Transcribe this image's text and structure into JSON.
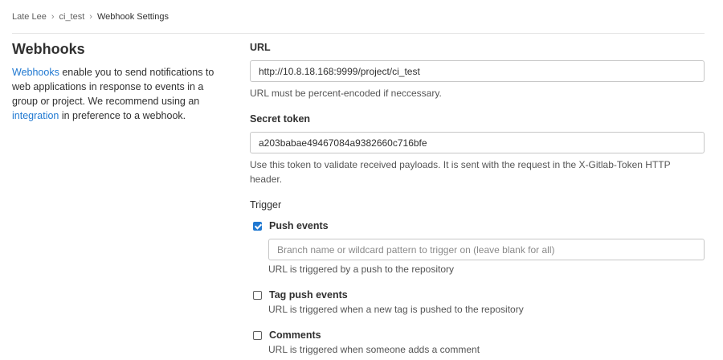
{
  "breadcrumb": {
    "items": [
      "Late Lee",
      "ci_test"
    ],
    "current": "Webhook Settings",
    "separator": "›"
  },
  "sidebar": {
    "title": "Webhooks",
    "description": {
      "link1": "Webhooks",
      "text1": " enable you to send notifications to web applications in response to events in a group or project. We recommend using an ",
      "link2": "integration",
      "text2": " in preference to a webhook."
    }
  },
  "form": {
    "url": {
      "label": "URL",
      "value": "http://10.8.18.168:9999/project/ci_test",
      "help": "URL must be percent-encoded if neccessary."
    },
    "secret_token": {
      "label": "Secret token",
      "value": "a203babae49467084a9382660c716bfe",
      "help": "Use this token to validate received payloads. It is sent with the request in the X-Gitlab-Token HTTP header."
    },
    "trigger": {
      "label": "Trigger",
      "push_events": {
        "label": "Push events",
        "checked": true,
        "placeholder": "Branch name or wildcard pattern to trigger on (leave blank for all)",
        "help": "URL is triggered by a push to the repository"
      },
      "tag_push_events": {
        "label": "Tag push events",
        "checked": false,
        "help": "URL is triggered when a new tag is pushed to the repository"
      },
      "comments": {
        "label": "Comments",
        "checked": false,
        "help": "URL is triggered when someone adds a comment"
      }
    }
  },
  "colors": {
    "link": "#1f78d1",
    "checkbox_checked": "#1f78d1",
    "text": "#303030",
    "divider": "#e5e5e5"
  }
}
